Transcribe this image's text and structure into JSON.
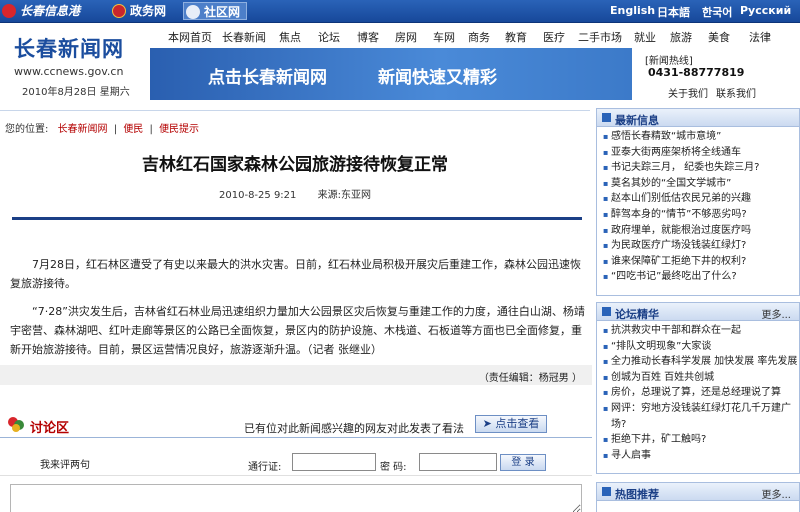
{
  "topbar": {
    "site_name": "长春信息港",
    "gov_label": "政务网",
    "community_label": "社区网",
    "languages": [
      "English",
      "日本語",
      "한국어",
      "Русский"
    ]
  },
  "header": {
    "logo_text": "长春新闻网",
    "logo_url": "www.ccnews.gov.cn",
    "date": "2010年8月28日 星期六",
    "nav": [
      "本网首页",
      "长春新闻",
      "焦点",
      "论坛",
      "博客",
      "房网",
      "车网",
      "商务",
      "教育",
      "医疗",
      "二手市场",
      "就业",
      "旅游",
      "美食",
      "法律"
    ],
    "banner": {
      "text1": "点击长春新闻网",
      "text2": "新闻快速又精彩"
    },
    "hotline_label": "[新闻热线]",
    "hotline_number": "0431-88777819",
    "about": "关于我们",
    "contact": "联系我们"
  },
  "breadcrumb": {
    "prefix": "您的位置:",
    "items": [
      "长春新闻网",
      "便民",
      "便民提示"
    ],
    "sep": "|"
  },
  "article": {
    "title": "吉林红石国家森林公园旅游接待恢复正常",
    "date": "2010-8-25 9:21",
    "source_label": "来源:",
    "source": "东亚网",
    "para1": "7月28日，红石林区遭受了有史以来最大的洪水灾害。日前，红石林业局积极开展灾后重建工作，森林公园迅速恢复旅游接待。",
    "para2": "“7·28”洪灾发生后，吉林省红石林业局迅速组织力量加大公园景区灾后恢复与重建工作的力度，通往白山湖、杨靖宇密营、森林湖吧、红叶走廊等景区的公路已全面恢复，景区内的防护设施、木栈道、石板道等方面也已全面修复，重新开始旅游接待。目前，景区运营情况良好，旅游逐渐升温。（记者 张继业）",
    "editor": "（责任编辑：杨冠男 ）"
  },
  "comments": {
    "title": "讨论区",
    "prompt": "已有位对此新闻感兴趣的网友对此发表了看法",
    "view_button": "点击查看",
    "count_text": "我来评两句",
    "pass_label": "通行证:",
    "pass_value": "",
    "pwd_label": "密  码:",
    "pwd_value": "",
    "login_button": "登 录"
  },
  "sidebar": {
    "latest": {
      "title": "最新信息",
      "items": [
        "感悟长春精致“城市意境”",
        "亚泰大街两座架桥将全线通车",
        "书记夫踪三月，  纪委也失踪三月?",
        "莫名其妙的“全国文学城市”",
        "赵本山们别低估农民兄弟的兴趣",
        "醉驾本身的“情节”不够恶劣吗?",
        "政府埋单，就能根治过度医疗吗",
        "为民政医疗广场没钱装红绿灯?",
        "谁来保障矿工拒绝下井的权利?",
        "“四吃书记”最终吃出了什么?"
      ]
    },
    "forum": {
      "title": "论坛精华",
      "more": "更多...",
      "items": [
        "抗洪救灾中干部和群众在一起",
        "“排队文明现象”大家谈",
        "全力推动长春科学发展 加快发展 率先发展",
        "创城为百姓 百姓共创城",
        "房价，总理说了算，还是总经理说了算",
        "网评：穷地方没钱装红绿灯花几千万建广场?",
        "拒绝下井，矿工触吗?",
        "寻人启事"
      ]
    },
    "hot": {
      "title": "热图推荐",
      "more": "更多..."
    }
  },
  "colors": {
    "brand_blue": "#1b4d9e",
    "accent_red": "#b40000",
    "rule_navy": "#1b3f86"
  }
}
